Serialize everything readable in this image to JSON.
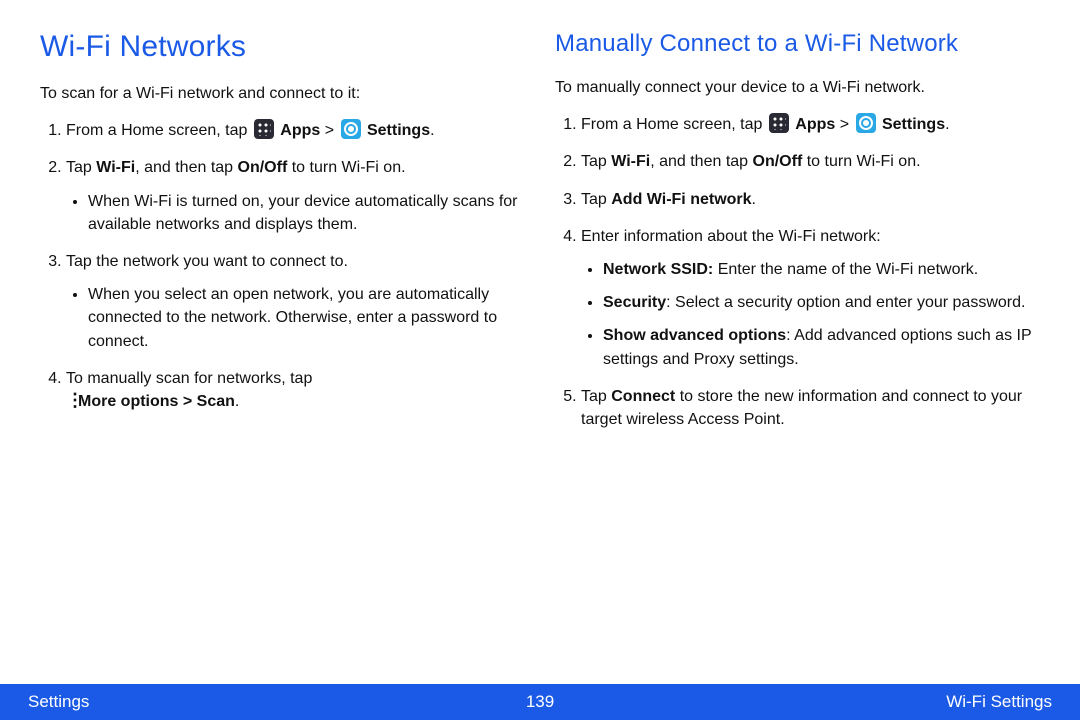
{
  "left": {
    "title": "Wi-Fi Networks",
    "intro": "To scan for a Wi-Fi network and connect to it:",
    "step1_pre": "From a Home screen, tap ",
    "apps_label": "Apps",
    "gt": " > ",
    "settings_label": "Settings",
    "period": ".",
    "step2_a": "Tap ",
    "step2_b": "Wi-Fi",
    "step2_c": ", and then tap ",
    "step2_d": "On/Off",
    "step2_e": " to turn Wi-Fi on.",
    "step2_bullet": "When Wi-Fi is turned on, your device automatically scans for available networks and displays them.",
    "step3": "Tap the network you want to connect to.",
    "step3_bullet": "When you select an open network, you are automatically connected to the network. Otherwise, enter a password to connect.",
    "step4_a": "To manually scan for networks, tap",
    "step4_b": "More options > Scan"
  },
  "right": {
    "title": "Manually Connect to a Wi-Fi Network",
    "intro": "To manually connect your device to a Wi-Fi network.",
    "step1_pre": "From a Home screen, tap ",
    "apps_label": "Apps",
    "gt": " > ",
    "settings_label": "Settings",
    "period": ".",
    "step2_a": "Tap ",
    "step2_b": "Wi-Fi",
    "step2_c": ", and then tap ",
    "step2_d": "On/Off",
    "step2_e": " to turn Wi-Fi on.",
    "step3_a": "Tap ",
    "step3_b": "Add Wi-Fi network",
    "step3_c": ".",
    "step4": "Enter information about the Wi-Fi network:",
    "b1_a": "Network SSID:",
    "b1_b": " Enter the name of the Wi-Fi network.",
    "b2_a": "Security",
    "b2_b": ": Select a security option and enter your password.",
    "b3_a": "Show advanced options",
    "b3_b": ": Add advanced options such as IP settings and Proxy settings.",
    "step5_a": "Tap ",
    "step5_b": "Connect",
    "step5_c": " to store the new information and connect to your target wireless Access Point."
  },
  "footer": {
    "left": "Settings",
    "center": "139",
    "right": "Wi-Fi Settings"
  }
}
